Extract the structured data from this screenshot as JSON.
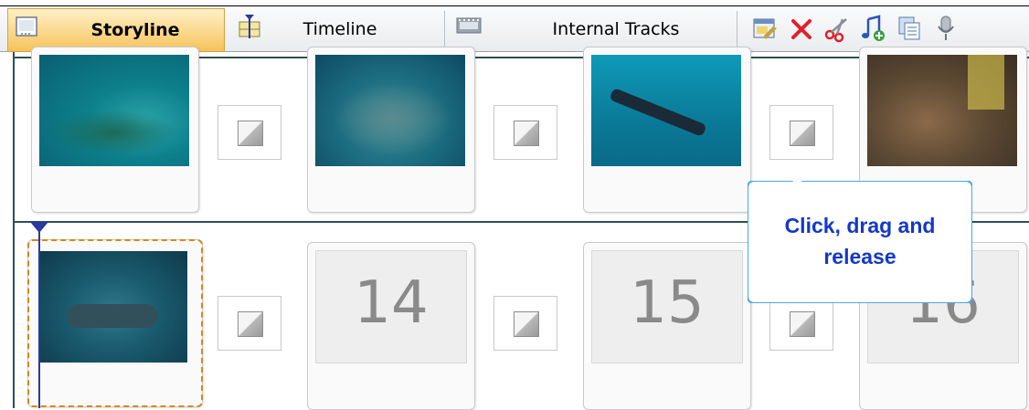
{
  "tabs": [
    {
      "label": "Storyline",
      "active": true,
      "icon": "storyline-icon"
    },
    {
      "label": "Timeline",
      "active": false,
      "icon": "timeline-icon"
    },
    {
      "label": "Internal Tracks",
      "active": false,
      "icon": "film-strip-icon"
    }
  ],
  "toolbar": [
    "properties-icon",
    "delete-icon",
    "cut-icon",
    "add-music-icon",
    "add-text-icon",
    "record-narration-icon"
  ],
  "row2_placeholders": [
    "14",
    "15",
    "16"
  ],
  "callout": {
    "line1": "Click, drag and",
    "line2": "release"
  },
  "colors": {
    "active_tab": "#f6c35a",
    "accent": "#1438c8",
    "selection": "#d08a1c"
  }
}
